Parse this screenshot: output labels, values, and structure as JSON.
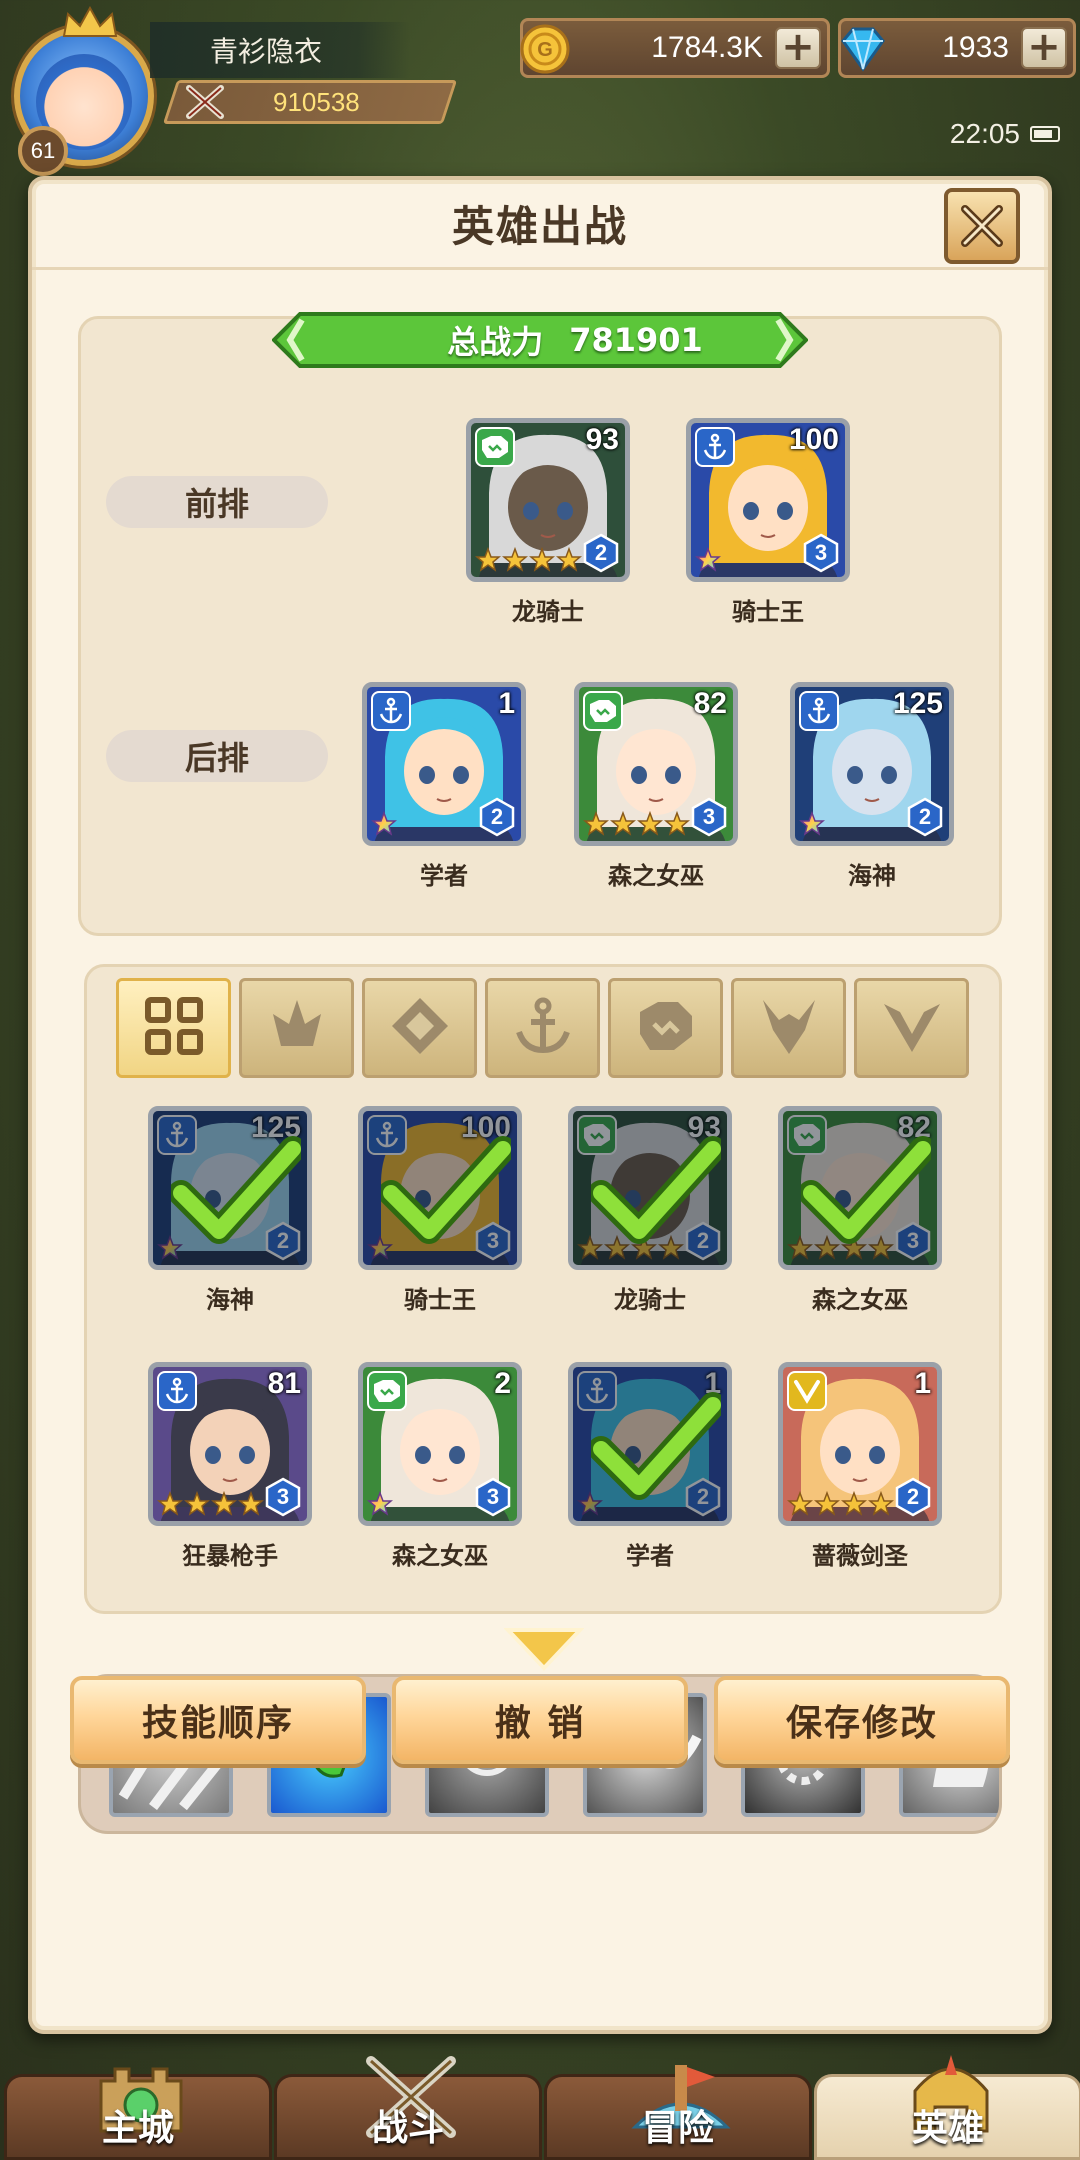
{
  "player": {
    "name": "青衫隐衣",
    "power": "910538",
    "level": "61"
  },
  "currency": {
    "gold": "1784.3K",
    "gems": "1933"
  },
  "status_bar": {
    "time": "22:05"
  },
  "panel": {
    "title": "英雄出战",
    "total_power_label": "总战力",
    "total_power": "781901",
    "front_row_label": "前排",
    "back_row_label": "后排"
  },
  "front_row": [
    {
      "name": "龙骑士",
      "level": "93",
      "grade": "2",
      "element": "beast-icon",
      "stars": 4,
      "hair": "#d8d8d8",
      "skin": "#6a5a4a",
      "bg": "#2e4f3a"
    },
    {
      "name": "骑士王",
      "level": "100",
      "grade": "3",
      "element": "anchor-icon",
      "stars": 1,
      "hair": "#f2b92e",
      "skin": "#ffe0c4",
      "bg": "#2a4aa8"
    }
  ],
  "back_row": [
    {
      "name": "学者",
      "level": "1",
      "grade": "2",
      "element": "anchor-icon",
      "stars": 1,
      "hair": "#3fc2e6",
      "skin": "#ffe0c4",
      "bg": "#2a4aa8"
    },
    {
      "name": "森之女巫",
      "level": "82",
      "grade": "3",
      "element": "beast-icon",
      "stars": 4,
      "hair": "#efe6da",
      "skin": "#ffe6d2",
      "bg": "#3c8a3a"
    },
    {
      "name": "海神",
      "level": "125",
      "grade": "2",
      "element": "anchor-icon",
      "stars": 1,
      "hair": "#9fd6ee",
      "skin": "#d8e2ee",
      "bg": "#1f3f78"
    }
  ],
  "filters": [
    {
      "icon": "all-grid-icon",
      "active": true
    },
    {
      "icon": "fire-icon",
      "active": false
    },
    {
      "icon": "diamond-rune-icon",
      "active": false
    },
    {
      "icon": "anchor-icon",
      "active": false
    },
    {
      "icon": "beast-icon",
      "active": false
    },
    {
      "icon": "demon-horn-icon",
      "active": false
    },
    {
      "icon": "wing-v-icon",
      "active": false
    }
  ],
  "roster": [
    {
      "name": "海神",
      "level": "125",
      "grade": "2",
      "element": "anchor-icon",
      "stars": 1,
      "selected": true,
      "hair": "#9fd6ee",
      "skin": "#d8e2ee",
      "bg": "#1f3f78"
    },
    {
      "name": "骑士王",
      "level": "100",
      "grade": "3",
      "element": "anchor-icon",
      "stars": 1,
      "selected": true,
      "hair": "#f2b92e",
      "skin": "#ffe0c4",
      "bg": "#2a4aa8"
    },
    {
      "name": "龙骑士",
      "level": "93",
      "grade": "2",
      "element": "beast-icon",
      "stars": 4,
      "selected": true,
      "hair": "#d8d8d8",
      "skin": "#6a5a4a",
      "bg": "#2e4f3a"
    },
    {
      "name": "森之女巫",
      "level": "82",
      "grade": "3",
      "element": "beast-icon",
      "stars": 4,
      "selected": true,
      "hair": "#efe6da",
      "skin": "#ffe6d2",
      "bg": "#3c8a3a"
    },
    {
      "name": "狂暴枪手",
      "level": "81",
      "grade": "3",
      "element": "anchor-icon",
      "stars": 4,
      "selected": false,
      "hair": "#3a3a4a",
      "skin": "#f3d2b8",
      "bg": "#5a4a8a"
    },
    {
      "name": "森之女巫",
      "level": "2",
      "grade": "3",
      "element": "beast-icon",
      "stars": 1,
      "selected": false,
      "hair": "#efe6da",
      "skin": "#ffe6d2",
      "bg": "#3c8a3a"
    },
    {
      "name": "学者",
      "level": "1",
      "grade": "2",
      "element": "anchor-icon",
      "stars": 1,
      "selected": true,
      "hair": "#3fc2e6",
      "skin": "#ffe0c4",
      "bg": "#2a4aa8"
    },
    {
      "name": "蔷薇剑圣",
      "level": "1",
      "grade": "2",
      "element": "light-icon",
      "stars": 4,
      "selected": false,
      "hair": "#f5c47a",
      "skin": "#ffe0c4",
      "bg": "#c86a5a"
    }
  ],
  "skills": [
    {
      "icon": "slash-skill-icon",
      "active": false
    },
    {
      "icon": "leaf-skill-icon",
      "active": true
    },
    {
      "icon": "vortex-skill-icon",
      "active": false
    },
    {
      "icon": "wave-skill-icon",
      "active": false
    },
    {
      "icon": "gear-skill-icon",
      "active": false
    },
    {
      "icon": "spirit-skill-icon",
      "active": false
    }
  ],
  "actions": {
    "skill_order": "技能顺序",
    "undo": "撤 销",
    "save": "保存修改"
  },
  "nav": [
    {
      "label": "主城",
      "icon": "castle-icon",
      "active": false
    },
    {
      "label": "战斗",
      "icon": "crossed-swords-icon",
      "active": false
    },
    {
      "label": "冒险",
      "icon": "adventure-icon",
      "active": false
    },
    {
      "label": "英雄",
      "icon": "hero-helmet-icon",
      "active": true
    }
  ],
  "colors": {
    "panel_bg": "#fbf3e4",
    "banner_green": "#5cc63a",
    "button_orange": "#f3b566",
    "gold_text": "#ffe27a"
  }
}
